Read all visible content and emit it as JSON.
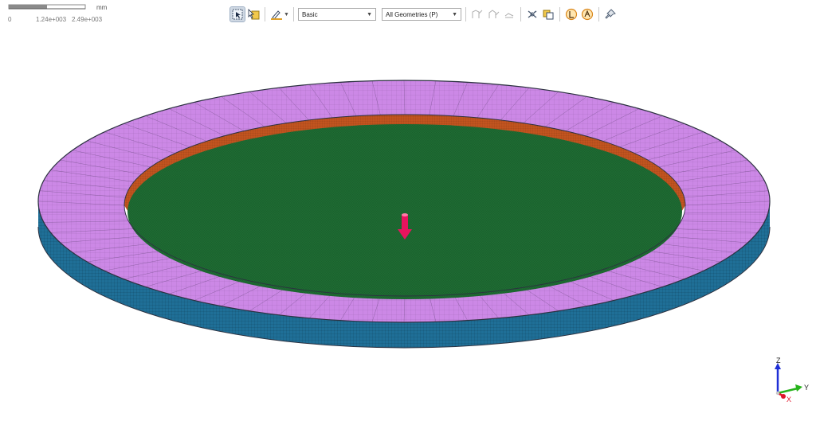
{
  "scale_bar": {
    "unit": "mm",
    "ticks": [
      "0",
      "1.24e+003",
      "2.49e+003"
    ]
  },
  "toolbar": {
    "buttons": [
      {
        "name": "select-mode-button",
        "icon": "box-select-icon",
        "active": true
      },
      {
        "name": "select-type-button",
        "icon": "cursor-select-icon"
      },
      {
        "name": "extend-button",
        "icon": "pen-extend-icon"
      },
      {
        "name": "selection-filter-button",
        "icon": "filter-icon",
        "dim": true
      },
      {
        "name": "select-adjacent-button",
        "icon": "adjacent-icon",
        "dim": true
      },
      {
        "name": "select-all-button",
        "icon": "select-all-icon",
        "dim": true
      },
      {
        "name": "hide-button",
        "icon": "hide-icon"
      },
      {
        "name": "show-button",
        "icon": "show-icon"
      },
      {
        "name": "annotation-button",
        "icon": "annotation-icon"
      },
      {
        "name": "reset-view-button",
        "icon": "reset-view-icon"
      },
      {
        "name": "pin-button",
        "icon": "pin-icon"
      }
    ],
    "select_mode": "Basic",
    "geometry_filter": "All Geometries (P)"
  },
  "model": {
    "colors": {
      "top_ring": "#cc88e6",
      "side_wall": "#1f6f97",
      "inner_wall": "#c2541f",
      "floor": "#1e6b32",
      "load_arrow": "#e8145e",
      "outline": "#2c3140"
    }
  },
  "triad": {
    "z_label": "Z",
    "y_label": "Y",
    "x_label": "X",
    "colors": {
      "z": "#1f2fd6",
      "y": "#27b31b",
      "x": "#e0162b"
    }
  }
}
